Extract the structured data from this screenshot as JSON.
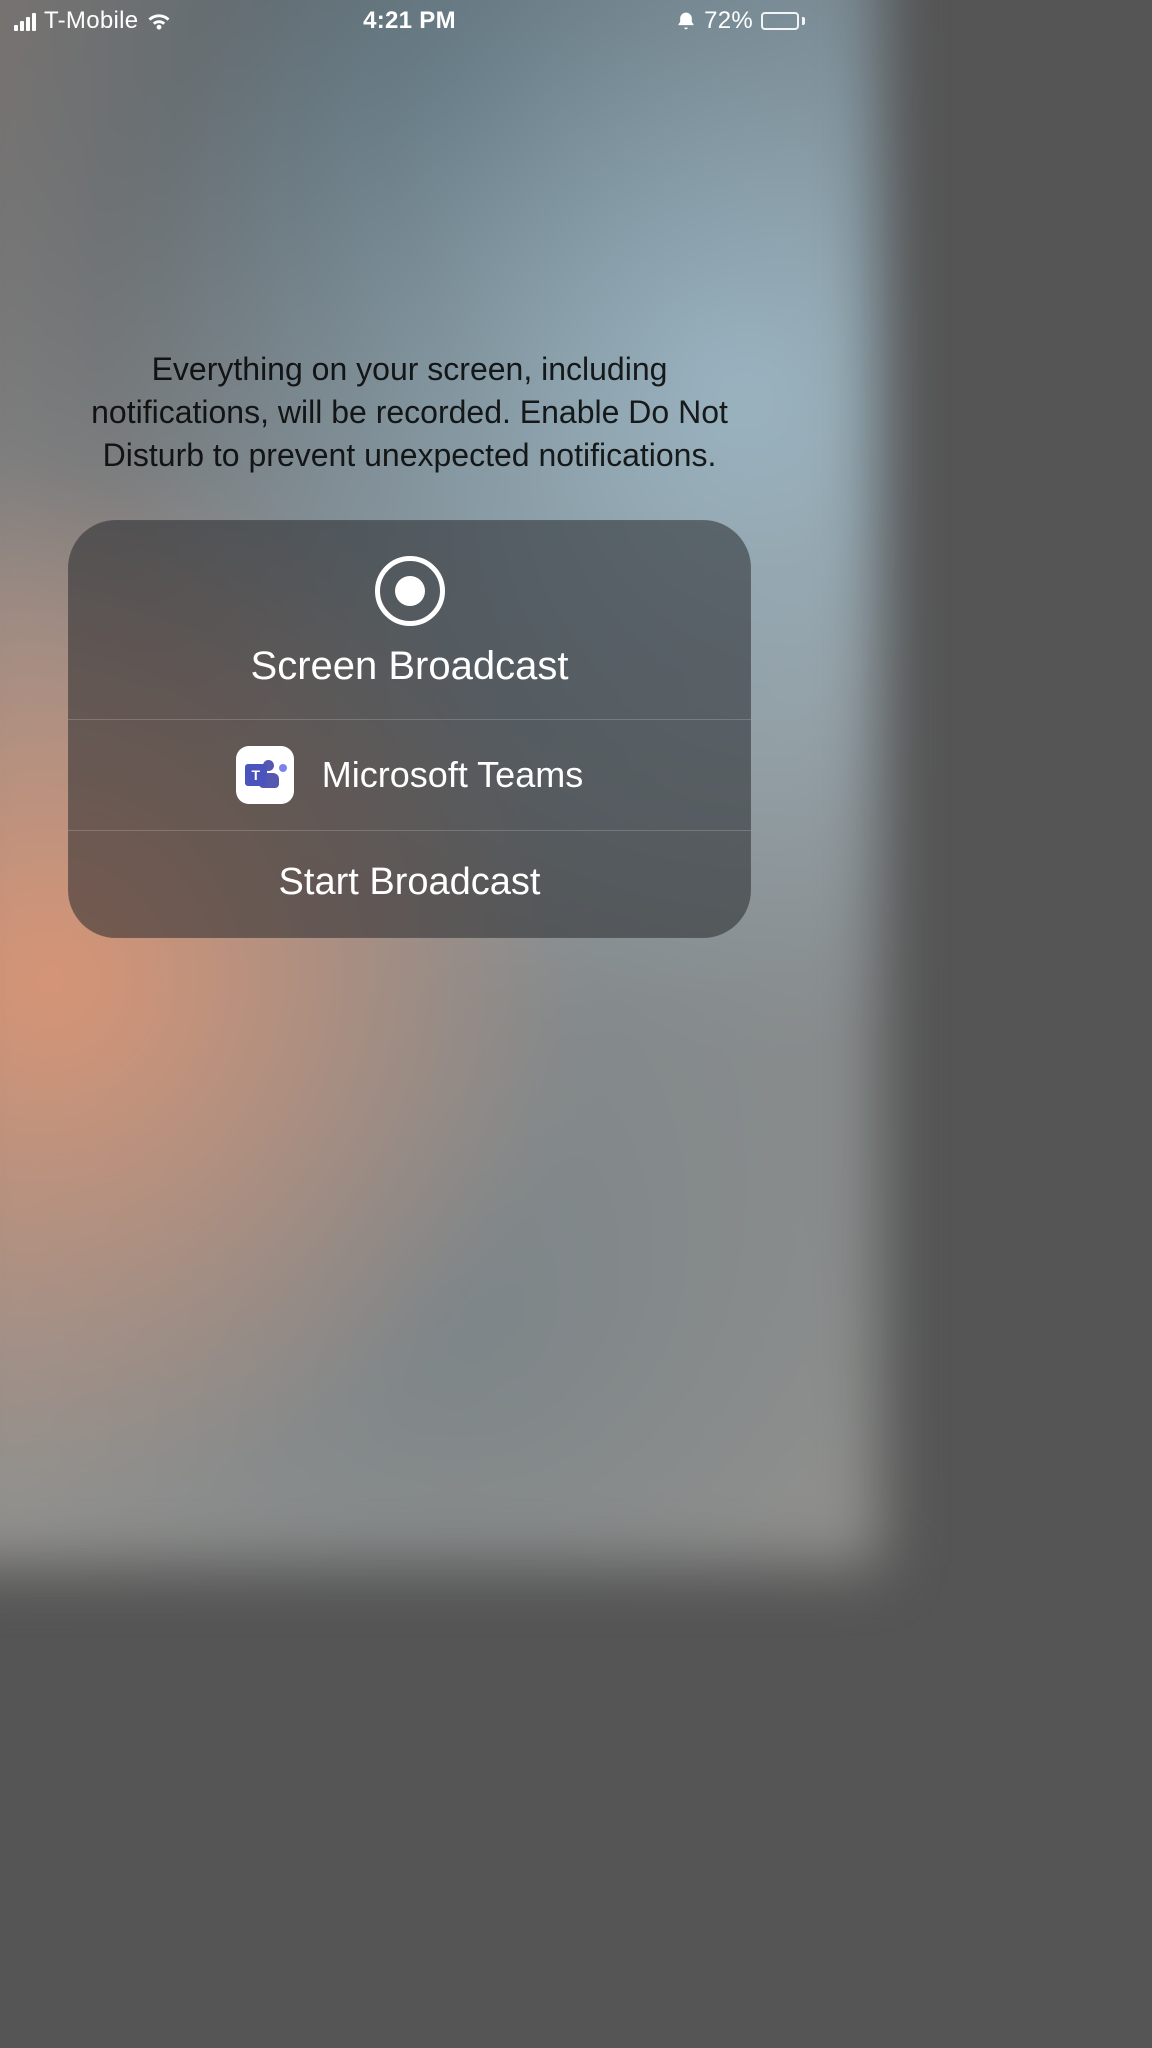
{
  "status": {
    "carrier": "T-Mobile",
    "time": "4:21 PM",
    "battery_pct": "72%",
    "battery_fill_pct": 72
  },
  "warning": "Everything on your screen, including notifications, will be recorded. Enable Do Not Disturb to prevent unexpected notifications.",
  "panel": {
    "title": "Screen Broadcast",
    "app_name": "Microsoft Teams",
    "app_icon_letter": "T",
    "start_label": "Start Broadcast"
  }
}
